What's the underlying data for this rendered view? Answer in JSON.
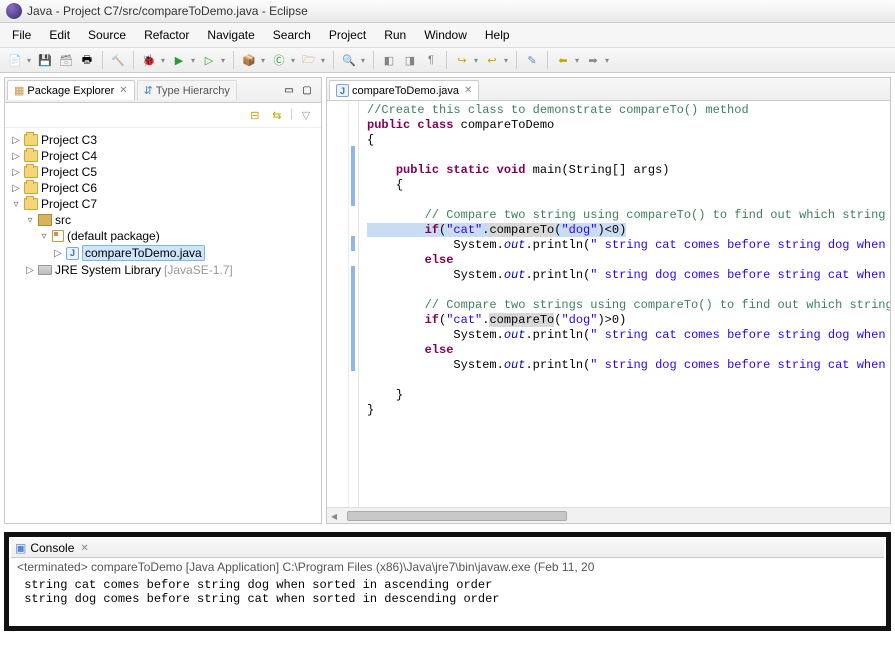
{
  "window": {
    "title": "Java - Project C7/src/compareToDemo.java - Eclipse"
  },
  "menu": {
    "file": "File",
    "edit": "Edit",
    "source": "Source",
    "refactor": "Refactor",
    "navigate": "Navigate",
    "search": "Search",
    "project": "Project",
    "run": "Run",
    "window": "Window",
    "help": "Help"
  },
  "leftpane": {
    "tab1": "Package Explorer",
    "tab2": "Type Hierarchy",
    "projects": [
      "Project C3",
      "Project C4",
      "Project C5",
      "Project C6",
      "Project C7"
    ],
    "src": "src",
    "defaultpkg": "(default package)",
    "javafile": "compareToDemo.java",
    "jrelib": "JRE System Library",
    "jrever": "[JavaSE-1.7]"
  },
  "editor": {
    "tab": "compareToDemo.java",
    "l1": "//Create this class to demonstrate compareTo() method",
    "l2a": "public",
    "l2b": " class",
    "l2c": " compareToDemo",
    "l3": "{",
    "l5a": "public",
    "l5b": " static",
    "l5c": " void",
    "l5d": " main(String[] args)",
    "l6": "{",
    "l8": "// Compare two string using compareTo() to find out which string comes ",
    "l9a": "if",
    "l9b": "(",
    "l9c": "\"cat\"",
    "l9d": ".",
    "l9e": "compareTo",
    "l9f": "(",
    "l9g": "\"dog\"",
    "l9h": ")<0)",
    "l10a": "System.",
    "l10b": "out",
    "l10c": ".println(",
    "l10d": "\" string cat comes before string dog when sort",
    "l10e": "",
    "l11": "else",
    "l12d": "\" string dog comes before string cat when sort",
    "l14": "// Compare two strings using compareTo() to find out which string comes",
    "l15h": ")>0)",
    "l16d": "\" string cat comes before string dog when sort",
    "l18d": "\" string dog comes before string cat when sort",
    "l20": "}",
    "l21": "}"
  },
  "console": {
    "tab": "Console",
    "status": "<terminated> compareToDemo [Java Application] C:\\Program Files (x86)\\Java\\jre7\\bin\\javaw.exe (Feb 11, 20",
    "out1": "string cat comes before string dog when sorted in ascending order",
    "out2": "string dog comes before string cat when sorted in descending order"
  }
}
